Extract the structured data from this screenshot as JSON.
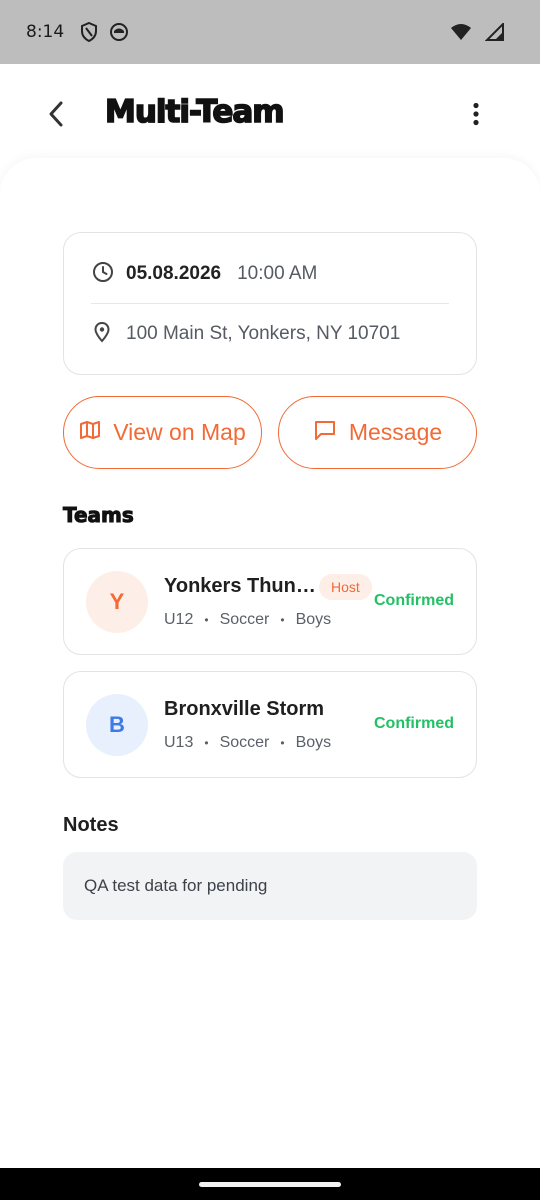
{
  "status_bar": {
    "time": "8:14"
  },
  "header": {
    "title": "Multi-Team"
  },
  "event": {
    "date": "05.08.2026",
    "time": "10:00 AM",
    "address": "100 Main St, Yonkers, NY 10701"
  },
  "actions": {
    "map_label": "View on Map",
    "message_label": "Message"
  },
  "teams": {
    "title": "Teams",
    "items": [
      {
        "initial": "Y",
        "name": "Yonkers Thun…",
        "badge": "Host",
        "age": "U12",
        "sport": "Soccer",
        "gender": "Boys",
        "status": "Confirmed"
      },
      {
        "initial": "B",
        "name": "Bronxville Storm",
        "age": "U13",
        "sport": "Soccer",
        "gender": "Boys",
        "status": "Confirmed"
      }
    ]
  },
  "notes": {
    "title": "Notes",
    "text": "QA test data for pending"
  },
  "colors": {
    "accent": "#f26a35",
    "confirmed": "#23c065",
    "avatar_blue": "#3b7be8"
  }
}
